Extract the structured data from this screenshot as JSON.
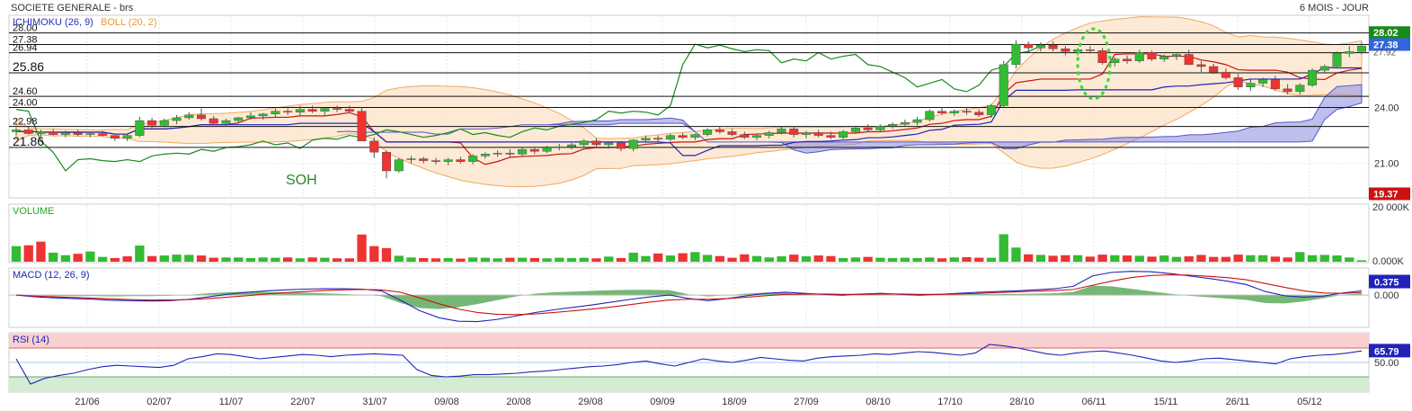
{
  "header": {
    "title": "SOCIETE GENERALE - brs",
    "period": "6 MOIS - JOUR"
  },
  "chart_data": [
    {
      "panel": "price",
      "type": "candlestick",
      "indicators": {
        "ichimoku": "ICHIMOKU (26, 9)",
        "boll": "BOLL (20, 2)"
      },
      "annotation": "SOH",
      "ylim": [
        19.2,
        28.9
      ],
      "y_ticks": [
        21.0,
        24.0
      ],
      "y_tick_labels": [
        "21.00",
        "24.00"
      ],
      "h_levels": [
        28.0,
        27.38,
        26.94,
        25.86,
        24.6,
        24.0,
        22.98,
        21.86
      ],
      "h_level_labels": [
        "28.00",
        "27.38",
        "26.94",
        "25.86",
        "24.60",
        "24.00",
        "22.98",
        "21.86"
      ],
      "right_badges": [
        {
          "label": "28.02",
          "value": 28.02,
          "color": "#1a8a1a"
        },
        {
          "label": "27.38",
          "value": 27.38,
          "color": "#3366dd"
        },
        {
          "label": "19.37",
          "value": 19.37,
          "color": "#cc1111"
        }
      ],
      "last_label": "27.92",
      "dates": [
        "21/06",
        "02/07",
        "11/07",
        "22/07",
        "31/07",
        "09/08",
        "20/08",
        "29/08",
        "09/09",
        "18/09",
        "27/09",
        "08/10",
        "17/10",
        "28/10",
        "06/11",
        "15/11",
        "26/11",
        "05/12"
      ],
      "candles": [
        [
          22.7,
          22.9,
          22.5,
          22.8
        ],
        [
          22.8,
          22.95,
          22.55,
          22.6
        ],
        [
          22.6,
          22.8,
          22.4,
          22.7
        ],
        [
          22.7,
          22.85,
          22.5,
          22.55
        ],
        [
          22.55,
          22.75,
          22.4,
          22.65
        ],
        [
          22.65,
          22.8,
          22.45,
          22.55
        ],
        [
          22.55,
          22.7,
          22.4,
          22.6
        ],
        [
          22.6,
          22.75,
          22.45,
          22.5
        ],
        [
          22.5,
          22.6,
          22.2,
          22.35
        ],
        [
          22.35,
          22.6,
          22.2,
          22.5
        ],
        [
          22.5,
          23.5,
          22.4,
          23.3
        ],
        [
          23.3,
          23.45,
          22.9,
          23.05
        ],
        [
          23.05,
          23.4,
          22.95,
          23.3
        ],
        [
          23.3,
          23.6,
          23.1,
          23.45
        ],
        [
          23.45,
          23.75,
          23.35,
          23.6
        ],
        [
          23.6,
          23.95,
          23.3,
          23.4
        ],
        [
          23.4,
          23.55,
          23.05,
          23.15
        ],
        [
          23.15,
          23.4,
          23.0,
          23.3
        ],
        [
          23.3,
          23.5,
          23.15,
          23.45
        ],
        [
          23.45,
          23.75,
          23.35,
          23.55
        ],
        [
          23.55,
          23.7,
          23.35,
          23.65
        ],
        [
          23.65,
          23.95,
          23.5,
          23.8
        ],
        [
          23.8,
          23.95,
          23.6,
          23.75
        ],
        [
          23.75,
          24.1,
          23.55,
          23.9
        ],
        [
          23.9,
          24.1,
          23.7,
          23.8
        ],
        [
          23.8,
          24.0,
          23.6,
          23.95
        ],
        [
          23.95,
          24.1,
          23.75,
          23.9
        ],
        [
          23.9,
          24.1,
          23.7,
          23.8
        ],
        [
          23.8,
          24.0,
          22.9,
          22.2
        ],
        [
          22.2,
          22.4,
          21.3,
          21.6
        ],
        [
          21.6,
          21.7,
          20.2,
          20.6
        ],
        [
          20.6,
          21.3,
          20.5,
          21.2
        ],
        [
          21.2,
          21.4,
          21.0,
          21.25
        ],
        [
          21.25,
          21.35,
          21.0,
          21.15
        ],
        [
          21.15,
          21.3,
          20.95,
          21.1
        ],
        [
          21.1,
          21.3,
          20.9,
          21.2
        ],
        [
          21.2,
          21.35,
          21.0,
          21.1
        ],
        [
          21.1,
          21.5,
          20.95,
          21.4
        ],
        [
          21.4,
          21.6,
          21.25,
          21.5
        ],
        [
          21.5,
          21.7,
          21.35,
          21.55
        ],
        [
          21.55,
          21.75,
          21.35,
          21.5
        ],
        [
          21.5,
          21.85,
          21.4,
          21.75
        ],
        [
          21.75,
          21.9,
          21.5,
          21.65
        ],
        [
          21.65,
          21.95,
          21.55,
          21.85
        ],
        [
          21.85,
          22.05,
          21.7,
          21.9
        ],
        [
          21.9,
          22.1,
          21.75,
          22.0
        ],
        [
          22.0,
          22.3,
          21.85,
          22.2
        ],
        [
          22.2,
          22.35,
          21.9,
          22.0
        ],
        [
          22.0,
          22.2,
          21.8,
          22.1
        ],
        [
          22.1,
          22.2,
          21.65,
          21.8
        ],
        [
          21.8,
          22.3,
          21.65,
          22.25
        ],
        [
          22.25,
          22.5,
          22.1,
          22.35
        ],
        [
          22.35,
          22.5,
          22.15,
          22.3
        ],
        [
          22.3,
          22.6,
          22.2,
          22.5
        ],
        [
          22.5,
          22.65,
          22.3,
          22.4
        ],
        [
          22.4,
          22.6,
          22.25,
          22.55
        ],
        [
          22.55,
          22.9,
          22.45,
          22.8
        ],
        [
          22.8,
          23.0,
          22.6,
          22.7
        ],
        [
          22.7,
          22.85,
          22.45,
          22.55
        ],
        [
          22.55,
          22.7,
          22.3,
          22.4
        ],
        [
          22.4,
          22.6,
          22.25,
          22.5
        ],
        [
          22.5,
          22.75,
          22.35,
          22.65
        ],
        [
          22.65,
          23.0,
          22.55,
          22.85
        ],
        [
          22.85,
          23.0,
          22.4,
          22.55
        ],
        [
          22.55,
          22.75,
          22.35,
          22.65
        ],
        [
          22.65,
          22.8,
          22.4,
          22.5
        ],
        [
          22.5,
          22.7,
          22.3,
          22.4
        ],
        [
          22.4,
          22.8,
          22.3,
          22.7
        ],
        [
          22.7,
          23.0,
          22.6,
          22.9
        ],
        [
          22.9,
          23.1,
          22.7,
          22.8
        ],
        [
          22.8,
          23.1,
          22.7,
          23.0
        ],
        [
          23.0,
          23.2,
          22.85,
          23.1
        ],
        [
          23.1,
          23.35,
          22.95,
          23.2
        ],
        [
          23.2,
          23.5,
          23.05,
          23.35
        ],
        [
          23.35,
          23.9,
          23.25,
          23.8
        ],
        [
          23.8,
          24.0,
          23.6,
          23.7
        ],
        [
          23.7,
          23.9,
          23.55,
          23.8
        ],
        [
          23.8,
          24.0,
          23.6,
          23.75
        ],
        [
          23.75,
          23.9,
          23.5,
          23.6
        ],
        [
          23.6,
          24.2,
          23.45,
          24.1
        ],
        [
          24.1,
          26.5,
          24.0,
          26.3
        ],
        [
          26.3,
          27.6,
          26.1,
          27.4
        ],
        [
          27.4,
          27.55,
          27.0,
          27.2
        ],
        [
          27.2,
          27.5,
          27.0,
          27.35
        ],
        [
          27.35,
          27.55,
          27.0,
          27.15
        ],
        [
          27.15,
          27.3,
          26.8,
          27.0
        ],
        [
          27.0,
          27.2,
          26.8,
          27.1
        ],
        [
          27.1,
          27.3,
          26.9,
          27.05
        ],
        [
          27.05,
          27.2,
          26.3,
          26.4
        ],
        [
          26.4,
          26.7,
          26.2,
          26.6
        ],
        [
          26.6,
          26.8,
          26.35,
          26.5
        ],
        [
          26.5,
          27.1,
          26.4,
          26.95
        ],
        [
          26.95,
          27.05,
          26.5,
          26.6
        ],
        [
          26.6,
          26.85,
          26.45,
          26.75
        ],
        [
          26.75,
          26.9,
          26.55,
          26.85
        ],
        [
          26.85,
          27.1,
          26.5,
          26.3
        ],
        [
          26.3,
          26.5,
          25.9,
          26.2
        ],
        [
          26.2,
          26.35,
          25.8,
          25.9
        ],
        [
          25.9,
          26.1,
          25.5,
          25.6
        ],
        [
          25.6,
          25.8,
          24.95,
          25.1
        ],
        [
          25.1,
          25.5,
          24.9,
          25.3
        ],
        [
          25.3,
          25.6,
          25.1,
          25.5
        ],
        [
          25.5,
          25.7,
          24.9,
          25.0
        ],
        [
          25.0,
          25.25,
          24.7,
          24.85
        ],
        [
          24.85,
          25.3,
          24.7,
          25.2
        ],
        [
          25.2,
          26.1,
          25.1,
          26.0
        ],
        [
          26.0,
          26.3,
          25.85,
          26.2
        ],
        [
          26.2,
          27.0,
          26.1,
          26.9
        ],
        [
          26.9,
          27.3,
          26.7,
          27.0
        ],
        [
          27.0,
          27.5,
          26.85,
          27.3
        ]
      ]
    },
    {
      "panel": "volume",
      "type": "bar",
      "title": "VOLUME",
      "ylim": [
        0,
        20000
      ],
      "y_tick_labels": [
        "20 000K",
        "0.000K"
      ],
      "values": [
        5500,
        5800,
        7100,
        3200,
        2300,
        2800,
        3600,
        1700,
        1300,
        1900,
        5700,
        2000,
        2200,
        2500,
        2400,
        2200,
        1400,
        1500,
        1500,
        1300,
        1500,
        1400,
        1500,
        1200,
        1500,
        1400,
        1200,
        1200,
        9600,
        5500,
        4800,
        2100,
        1500,
        1300,
        1200,
        1300,
        1100,
        1500,
        1400,
        1200,
        1400,
        1400,
        1300,
        1200,
        1400,
        1300,
        1400,
        1200,
        1800,
        1300,
        3200,
        2000,
        2900,
        2200,
        3000,
        3400,
        2400,
        2000,
        1400,
        2600,
        2000,
        1500,
        1900,
        2500,
        1900,
        2200,
        2000,
        1300,
        1500,
        1700,
        1400,
        1300,
        1400,
        1300,
        1500,
        1200,
        1500,
        1600,
        1400,
        1400,
        9700,
        5000,
        2600,
        2400,
        2100,
        2300,
        2300,
        1800,
        2500,
        2300,
        2200,
        2100,
        1800,
        2200,
        1700,
        1900,
        2400,
        1700,
        1700,
        2500,
        2300,
        2300,
        1800,
        1500,
        3400,
        2300,
        2400,
        2200,
        1500,
        500
      ],
      "colors_up": [
        true,
        false,
        false,
        true,
        true,
        false,
        true,
        true,
        false,
        false,
        true,
        false,
        true,
        true,
        true,
        false,
        false,
        true,
        true,
        true,
        true,
        true,
        false,
        true,
        false,
        true,
        false,
        false,
        false,
        false,
        false,
        true,
        true,
        false,
        false,
        true,
        false,
        true,
        true,
        true,
        false,
        true,
        false,
        true,
        true,
        true,
        true,
        false,
        true,
        false,
        true,
        true,
        false,
        true,
        false,
        true,
        true,
        false,
        false,
        false,
        true,
        true,
        true,
        false,
        true,
        false,
        false,
        true,
        true,
        false,
        true,
        true,
        true,
        true,
        true,
        false,
        true,
        false,
        false,
        true,
        true,
        true,
        false,
        true,
        false,
        false,
        true,
        false,
        false,
        true,
        false,
        true,
        false,
        true,
        true,
        false,
        false,
        false,
        false,
        false,
        true,
        true,
        false,
        false,
        true,
        true,
        true,
        true,
        true,
        true
      ]
    },
    {
      "panel": "macd",
      "type": "line",
      "title": "MACD (12, 26, 9)",
      "ylim": [
        -0.9,
        0.75
      ],
      "y_tick_labels": [
        "0.000"
      ],
      "badge": {
        "label": "0.375",
        "value": 0.375,
        "color": "#2222bb"
      },
      "series": [
        {
          "name": "MACD",
          "color": "#2222bb",
          "values": [
            0.0,
            -0.05,
            -0.08,
            -0.1,
            -0.12,
            -0.15,
            -0.16,
            -0.17,
            -0.16,
            -0.12,
            -0.05,
            0.02,
            0.08,
            0.12,
            0.15,
            0.17,
            0.18,
            0.18,
            0.17,
            0.12,
            -0.15,
            -0.45,
            -0.65,
            -0.75,
            -0.76,
            -0.7,
            -0.6,
            -0.5,
            -0.42,
            -0.35,
            -0.28,
            -0.2,
            -0.12,
            -0.05,
            0.0,
            -0.1,
            -0.16,
            -0.1,
            -0.02,
            0.05,
            0.08,
            0.05,
            0.02,
            0.0,
            0.03,
            0.05,
            0.02,
            0.0,
            0.02,
            0.05,
            0.08,
            0.1,
            0.12,
            0.15,
            0.18,
            0.25,
            0.55,
            0.65,
            0.68,
            0.67,
            0.62,
            0.55,
            0.48,
            0.4,
            0.3,
            0.1,
            -0.02,
            -0.06,
            -0.03,
            0.06,
            0.12
          ]
        },
        {
          "name": "Signal",
          "color": "#cc1111",
          "values": [
            0.0,
            -0.03,
            -0.05,
            -0.07,
            -0.09,
            -0.11,
            -0.13,
            -0.14,
            -0.14,
            -0.13,
            -0.1,
            -0.06,
            -0.02,
            0.03,
            0.07,
            0.1,
            0.13,
            0.15,
            0.16,
            0.15,
            0.08,
            -0.08,
            -0.25,
            -0.4,
            -0.5,
            -0.55,
            -0.56,
            -0.54,
            -0.5,
            -0.45,
            -0.4,
            -0.34,
            -0.27,
            -0.2,
            -0.14,
            -0.12,
            -0.12,
            -0.1,
            -0.06,
            -0.02,
            0.02,
            0.03,
            0.03,
            0.02,
            0.02,
            0.03,
            0.03,
            0.02,
            0.02,
            0.03,
            0.05,
            0.07,
            0.09,
            0.11,
            0.13,
            0.16,
            0.28,
            0.4,
            0.5,
            0.56,
            0.58,
            0.57,
            0.54,
            0.5,
            0.44,
            0.33,
            0.22,
            0.12,
            0.06,
            0.05,
            0.07
          ]
        }
      ]
    },
    {
      "panel": "rsi",
      "type": "line",
      "title": "RSI (14)",
      "ylim": [
        10,
        90
      ],
      "overbought": 70,
      "oversold": 30,
      "y_tick_labels": [
        "50.00"
      ],
      "badge": {
        "label": "65.79",
        "value": 65.79,
        "color": "#2222bb"
      },
      "values": [
        55,
        20,
        28,
        32,
        35,
        40,
        44,
        46,
        45,
        44,
        43,
        46,
        55,
        58,
        62,
        61,
        58,
        55,
        57,
        59,
        61,
        60,
        58,
        60,
        61,
        62,
        61,
        60,
        40,
        32,
        30,
        31,
        33,
        33,
        34,
        35,
        37,
        38,
        40,
        42,
        44,
        45,
        47,
        50,
        52,
        48,
        45,
        50,
        55,
        52,
        50,
        53,
        57,
        55,
        53,
        52,
        56,
        58,
        59,
        60,
        62,
        61,
        63,
        65,
        64,
        62,
        60,
        63,
        75,
        73,
        70,
        66,
        62,
        60,
        63,
        65,
        66,
        63,
        60,
        56,
        52,
        50,
        52,
        55,
        56,
        54,
        52,
        50,
        48,
        55,
        58,
        60,
        61,
        63,
        66
      ]
    }
  ]
}
